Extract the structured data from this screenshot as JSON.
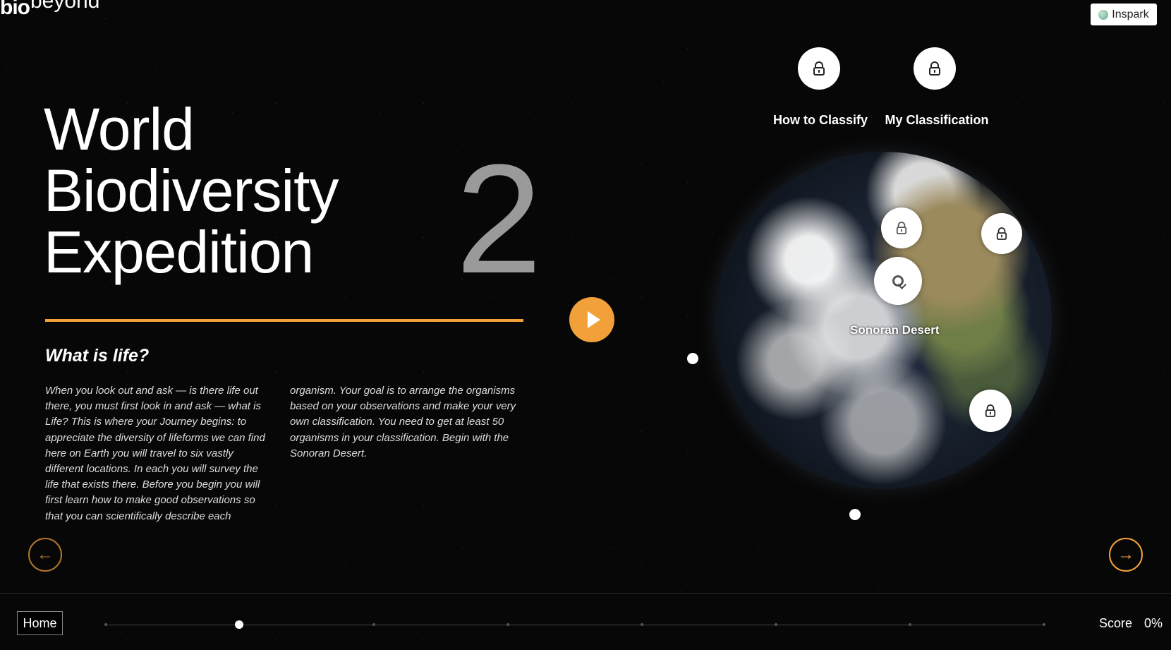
{
  "brand": {
    "logo_part1": "bio",
    "logo_part2": "beyond",
    "inspark_label": "Inspark"
  },
  "hero": {
    "title_line1": "World",
    "title_line2": "Biodiversity",
    "title_line3": "Expedition",
    "number": "2"
  },
  "intro": {
    "subtitle": "What is life?",
    "paragraph_col1": "When you look out and ask — is there life out there, you must first look in and ask — what is Life? This is where your Journey begins: to appreciate the diversity of lifeforms we can find here on Earth you will travel to six vastly different locations. In each you will survey the life that exists there. Before you begin you will first learn how to make good observations so that you can scientifically describe each",
    "paragraph_col2": "organism. Your goal is to arrange the organisms based on your observations and make your very own classification. You need to get at least 50 organisms in your classification. Begin with the Sonoran Desert."
  },
  "top_nav": [
    {
      "label": "How to Classify"
    },
    {
      "label": "My Classification"
    }
  ],
  "globe": {
    "location_label": "Sonoran Desert"
  },
  "footer": {
    "home_label": "Home",
    "score_label": "Score",
    "score_value": "0%",
    "progress_fraction": 0.13
  },
  "colors": {
    "accent": "#f2a13a",
    "background": "#070707",
    "text": "#ffffff",
    "muted_number": "#9a9a9a"
  },
  "icons": {
    "lock": "lock-icon",
    "play": "play-icon",
    "arrow_left": "arrow-left-icon",
    "arrow_right": "arrow-right-icon",
    "desert_pointer": "desert-pointer-icon"
  }
}
